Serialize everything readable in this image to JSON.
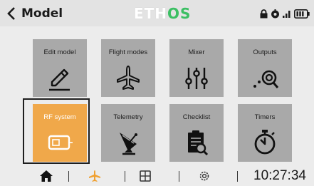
{
  "header": {
    "title": "Model",
    "brand_part1": "ETH",
    "brand_part2": "OS"
  },
  "tiles": [
    {
      "label": "Edit model",
      "icon": "pencil-icon",
      "selected": false
    },
    {
      "label": "Flight modes",
      "icon": "airplane-icon",
      "selected": false
    },
    {
      "label": "Mixer",
      "icon": "mixer-sliders-icon",
      "selected": false
    },
    {
      "label": "Outputs",
      "icon": "outputs-curve-icon",
      "selected": false
    },
    {
      "label": "RF system",
      "icon": "rf-module-icon",
      "selected": true
    },
    {
      "label": "Telemetry",
      "icon": "satellite-dish-icon",
      "selected": false
    },
    {
      "label": "Checklist",
      "icon": "checklist-icon",
      "selected": false
    },
    {
      "label": "Timers",
      "icon": "stopwatch-icon",
      "selected": false
    }
  ],
  "footer": {
    "time": "10:27:34",
    "nav_icons": [
      "home-icon",
      "airplane-icon",
      "screens-icon",
      "settings-gear-icon"
    ]
  },
  "colors": {
    "tile": "#a9a9a9",
    "tile_active": "#f0a84a",
    "brand_green": "#3bbf63",
    "nav_active": "#f0a030"
  }
}
